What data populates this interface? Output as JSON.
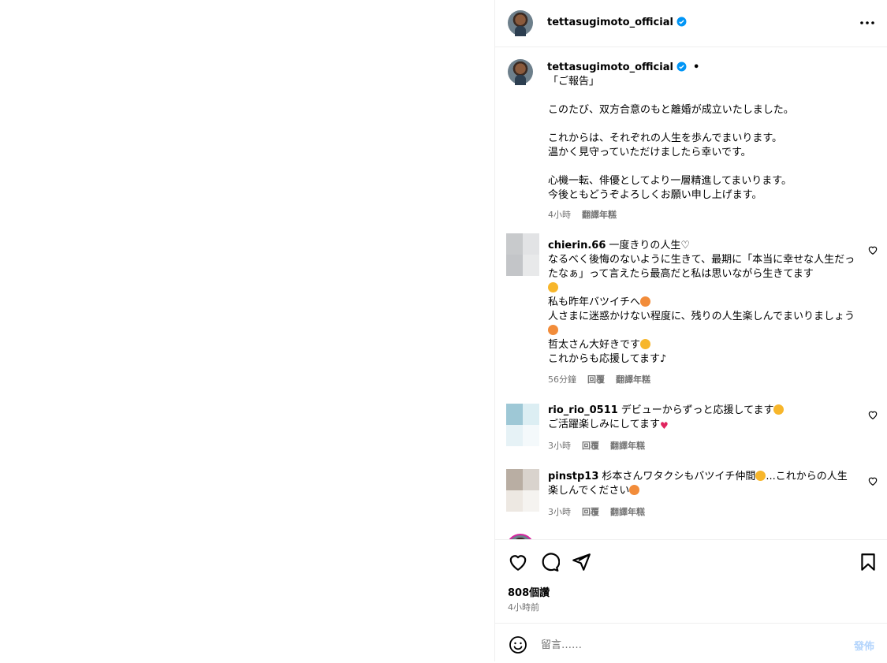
{
  "post": {
    "username": "tettasugimoto_official",
    "caption": "「ご報告」\n\nこのたび、双方合意のもと離婚が成立いたしました。\n\nこれからは、それぞれの人生を歩んでまいります。\n温かく見守っていただけましたら幸いです。\n\n心機一転、俳優としてより一層精進してまいります。\n今後ともどうぞよろしくお願い申し上げます。",
    "caption_time": "4小時",
    "translate_label": "翻譯年糕",
    "likes": "808個讚",
    "posted_ago": "4小時前"
  },
  "comments": [
    {
      "username": "chierin.66",
      "text": "一度きりの人生♡\nなるべく後悔のないように生きて、最期に「本当に幸せな人生だったなぁ」って言えたら最高だと私は思いながら生きてます",
      "text2": "私も昨年バツイチへ",
      "text3": "人さまに迷惑かけない程度に、残りの人生楽しんでまいりましょう",
      "text4": "哲太さん大好きです",
      "text5": "これからも応援してます♪",
      "time": "56分鐘",
      "reply": "回覆",
      "translate": "翻譯年糕"
    },
    {
      "username": "rio_rio_0511",
      "text": "デビューからずっと応援してます",
      "text2": "ご活躍楽しみにしてます",
      "time": "3小時",
      "reply": "回覆",
      "translate": "翻譯年糕"
    },
    {
      "username": "pinstp13",
      "text": "杉本さんワタクシもバツイチ仲間",
      "text2": "...これからの人生楽しんでください",
      "time": "3小時",
      "reply": "回覆",
      "translate": "翻譯年糕"
    }
  ],
  "comment_bar": {
    "placeholder": "留言……",
    "post_label": "發佈"
  },
  "icons": {
    "verified": "verified-badge-icon",
    "more": "more-options-icon",
    "like": "heart-icon",
    "comment": "comment-icon",
    "share": "share-icon",
    "save": "bookmark-icon",
    "emoji": "emoji-icon"
  },
  "colors": {
    "verified": "#0095f6",
    "post_button_disabled": "#b3d4fc",
    "muted_text": "#737373"
  }
}
